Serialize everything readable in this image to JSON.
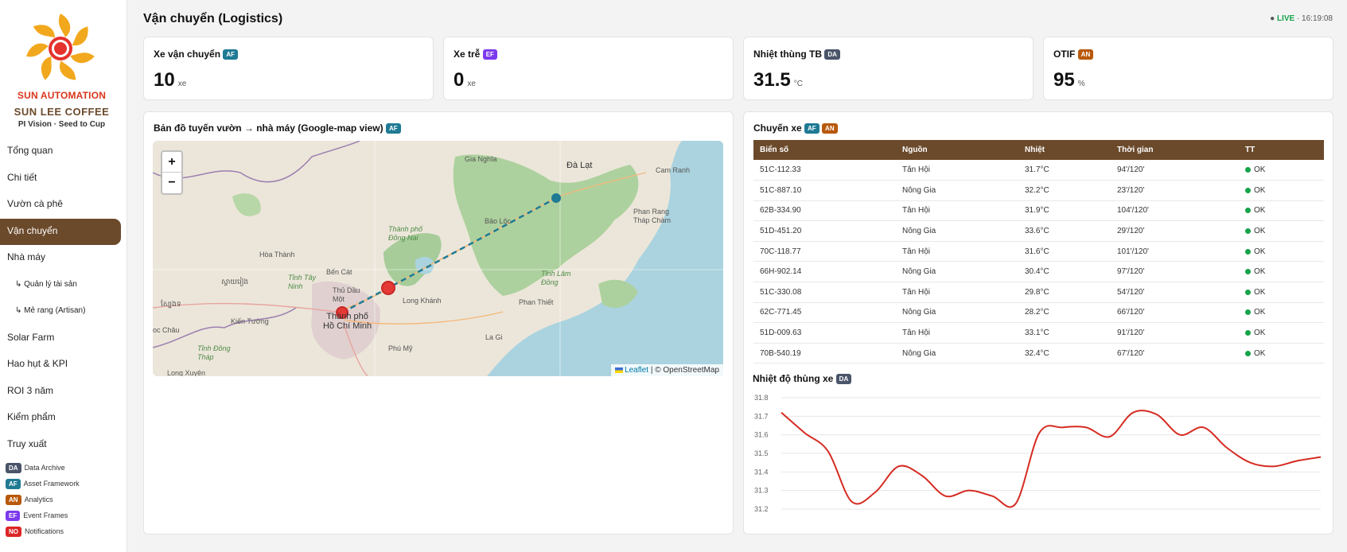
{
  "sidebar": {
    "brand_line1": "SUN AUTOMATION",
    "brand_line2": "SUN LEE COFFEE",
    "brand_line3": "PI Vision · Seed to Cup",
    "nav": [
      {
        "label": "Tổng quan"
      },
      {
        "label": "Chi tiết"
      },
      {
        "label": "Vườn cà phê"
      },
      {
        "label": "Vận chuyển",
        "active": true
      },
      {
        "label": "Nhà máy"
      },
      {
        "label": "↳ Quản lý tài sản"
      },
      {
        "label": "↳ Mẻ rang (Artisan)"
      },
      {
        "label": "Solar Farm"
      },
      {
        "label": "Hao hụt & KPI"
      },
      {
        "label": "ROI 3 năm"
      },
      {
        "label": "Kiểm phẩm"
      },
      {
        "label": "Truy xuất"
      }
    ],
    "legend": [
      {
        "code": "DA",
        "label": "Data Archive"
      },
      {
        "code": "AF",
        "label": "Asset Framework"
      },
      {
        "code": "AN",
        "label": "Analytics"
      },
      {
        "code": "EF",
        "label": "Event Frames"
      },
      {
        "code": "NO",
        "label": "Notifications"
      }
    ]
  },
  "header": {
    "title": "Vận chuyển (Logistics)",
    "live_dot": "●",
    "live_label": "LIVE",
    "live_time": "· 16:19:08"
  },
  "kpis": [
    {
      "title": "Xe vận chuyển",
      "badge": "AF",
      "value": "10",
      "unit": "xe"
    },
    {
      "title": "Xe trễ",
      "badge": "EF",
      "value": "0",
      "unit": "xe"
    },
    {
      "title": "Nhiệt thùng TB",
      "badge": "DA",
      "value": "31.5",
      "unit": "°C"
    },
    {
      "title": "OTIF",
      "badge": "AN",
      "value": "95",
      "unit": "%"
    }
  ],
  "map_panel": {
    "title": "Bản đồ tuyến vườn → nhà máy (Google-map view)",
    "badge": "AF",
    "zoom_in": "+",
    "zoom_out": "−",
    "attribution_link": "Leaflet",
    "attribution_text": " | © OpenStreetMap",
    "labels": [
      "Gia Nghĩa",
      "Đà Lạt",
      "Cam Ranh",
      "Bảo Lộc",
      "Phan Rang\nTháp Chàm",
      "Thành phố\nĐồng Nai",
      "Hòa Thành",
      "Bến Cát",
      "Tỉnh Tây\nNinh",
      "Thủ Dầu\nMột",
      "Long Khánh",
      "Tỉnh Lâm\nĐồng",
      "Phan Thiết",
      "Thành phố\nHồ Chí Minh",
      "Kiến Tường",
      "Tỉnh Đồng\nTháp",
      "Phú Mỹ",
      "La Gi",
      "Long Xuyên",
      "oc Châu",
      "ស្វាយរៀង",
      "ស្បែងទ"
    ]
  },
  "trips": {
    "title": "Chuyến xe",
    "badges": [
      "AF",
      "AN"
    ],
    "columns": [
      "Biển số",
      "Nguồn",
      "Nhiệt",
      "Thời gian",
      "TT"
    ],
    "rows": [
      [
        "51C-112.33",
        "Tân Hội",
        "31.7°C",
        "94'/120'",
        "OK"
      ],
      [
        "51C-887.10",
        "Nông Gia",
        "32.2°C",
        "23'/120'",
        "OK"
      ],
      [
        "62B-334.90",
        "Tân Hội",
        "31.9°C",
        "104'/120'",
        "OK"
      ],
      [
        "51D-451.20",
        "Nông Gia",
        "33.6°C",
        "29'/120'",
        "OK"
      ],
      [
        "70C-118.77",
        "Tân Hội",
        "31.6°C",
        "101'/120'",
        "OK"
      ],
      [
        "66H-902.14",
        "Nông Gia",
        "30.4°C",
        "97'/120'",
        "OK"
      ],
      [
        "51C-330.08",
        "Tân Hội",
        "29.8°C",
        "54'/120'",
        "OK"
      ],
      [
        "62C-771.45",
        "Nông Gia",
        "28.2°C",
        "66'/120'",
        "OK"
      ],
      [
        "51D-009.63",
        "Tân Hội",
        "33.1°C",
        "91'/120'",
        "OK"
      ],
      [
        "70B-540.19",
        "Nông Gia",
        "32.4°C",
        "67'/120'",
        "OK"
      ]
    ]
  },
  "temp_chart": {
    "title": "Nhiệt độ thùng xe",
    "badge": "DA"
  },
  "chart_data": {
    "type": "line",
    "title": "Nhiệt độ thùng xe",
    "xlabel": "",
    "ylabel": "",
    "ylim": [
      31.2,
      31.8
    ],
    "yticks": [
      "31.8",
      "31.7",
      "31.6",
      "31.5",
      "31.4",
      "31.3",
      "31.2"
    ],
    "grid": true,
    "color": "#d52c22",
    "series": [
      {
        "values": [
          31.72,
          31.61,
          31.51,
          31.24,
          31.29,
          31.43,
          31.38,
          31.27,
          31.3,
          31.27,
          31.23,
          31.61,
          31.64,
          31.64,
          31.59,
          31.72,
          31.71,
          31.6,
          31.64,
          31.53,
          31.45,
          31.43,
          31.46,
          31.48
        ]
      }
    ]
  }
}
